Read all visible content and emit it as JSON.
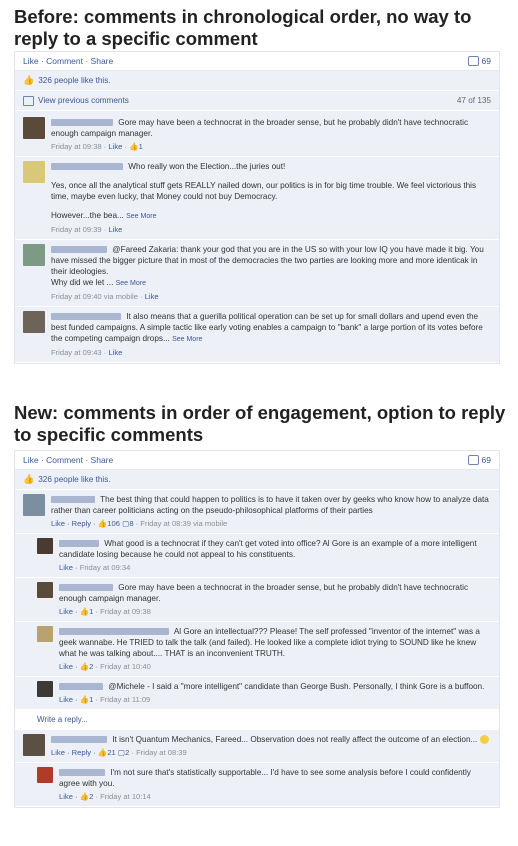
{
  "before": {
    "heading": "Before: comments in chronological order, no way to reply to a specific comment",
    "actions": "Like · Comment · Share",
    "comment_count": "69",
    "likes_text": "326 people like this.",
    "view_previous": "View previous comments",
    "pager": "47 of 135",
    "comments": [
      {
        "text": "Gore may have been a technocrat in the broader sense, but he probably didn't have technocratic enough campaign manager.",
        "time": "Friday at 09:38",
        "actions": "Like",
        "likes": "1"
      },
      {
        "text1": "Who really won the Election...the juries out!",
        "text2": "Yes, once all the analytical stuff gets REALLY nailed down, our politics is in for big time trouble. We feel victorious this time, maybe even lucky, that Money could not buy Democracy.",
        "text3": "However...the bea...",
        "see_more": "See More",
        "time": "Friday at 09:39",
        "actions": "Like"
      },
      {
        "text": "@Fareed Zakaria: thank your god that you are in the US so with your low IQ you have made it big. You have missed the bigger picture that in most of the democracies the two parties are looking more and more identicak in their ideologies.",
        "text2": "Why did we let ...",
        "see_more": "See More",
        "time": "Friday at 09:40 via mobile",
        "actions": "Like"
      },
      {
        "text": "It also means that a guerilla political operation can be set up for small dollars and upend even the best funded campaigns. A simple tactic like early voting enables a campaign to \"bank\" a large portion of its votes before the competing campaign drops...",
        "see_more": "See More",
        "time": "Friday at 09:43",
        "actions": "Like"
      }
    ]
  },
  "after": {
    "heading": "New: comments in order of engagement, option to reply to specific comments",
    "actions": "Like · Comment · Share",
    "comment_count": "69",
    "likes_text": "326 people like this.",
    "comments": [
      {
        "text": "The best thing that could happen to politics is to have it taken over by geeks who know how to analyze data rather than career politicians acting on the pseudo-philosophical platforms of their parties",
        "actions": "Like · Reply ·",
        "likes": "106",
        "replies": "8",
        "time": "· Friday at 08:39 via mobile"
      },
      {
        "text": "What good is a technocrat if they can't get voted into office? Al Gore is an example of a more intelligent candidate losing because he could not appeal to his constituents.",
        "actions": "Like ·",
        "time": "Friday at 09:34"
      },
      {
        "text": "Gore may have been a technocrat in the broader sense, but he probably didn't have technocratic enough campaign manager.",
        "actions": "Like ·",
        "likes": "1",
        "time": "· Friday at 09:38"
      },
      {
        "text": "Al Gore an intellectual??? Please! The self professed \"inventor of the internet\" was a geek wannabe. He TRIED to talk the talk (and failed). He looked like a complete idiot trying to SOUND like he knew what he was talking about.... THAT is an inconvenient TRUTH.",
        "actions": "Like ·",
        "likes": "2",
        "time": "· Friday at 10:40"
      },
      {
        "text": "@Michele - I said a \"more intelligent\" candidate than George Bush. Personally, I think Gore is a buffoon.",
        "actions": "Like ·",
        "likes": "1",
        "time": "· Friday at 11:09"
      },
      {
        "text": "It isn't Quantum Mechanics, Fareed... Observation does not really affect the outcome of an election...",
        "actions": "Like · Reply ·",
        "likes": "21",
        "replies": "2",
        "time": "· Friday at 08:39"
      },
      {
        "text": "I'm not sure that's statistically supportable... I'd have to see some analysis before I could confidently agree with you.",
        "actions": "Like ·",
        "likes": "2",
        "time": "· Friday at 10:14"
      }
    ],
    "write_reply": "Write a reply..."
  },
  "colors": {
    "link": "#3b5998",
    "row_bg": "#edf0f6"
  }
}
